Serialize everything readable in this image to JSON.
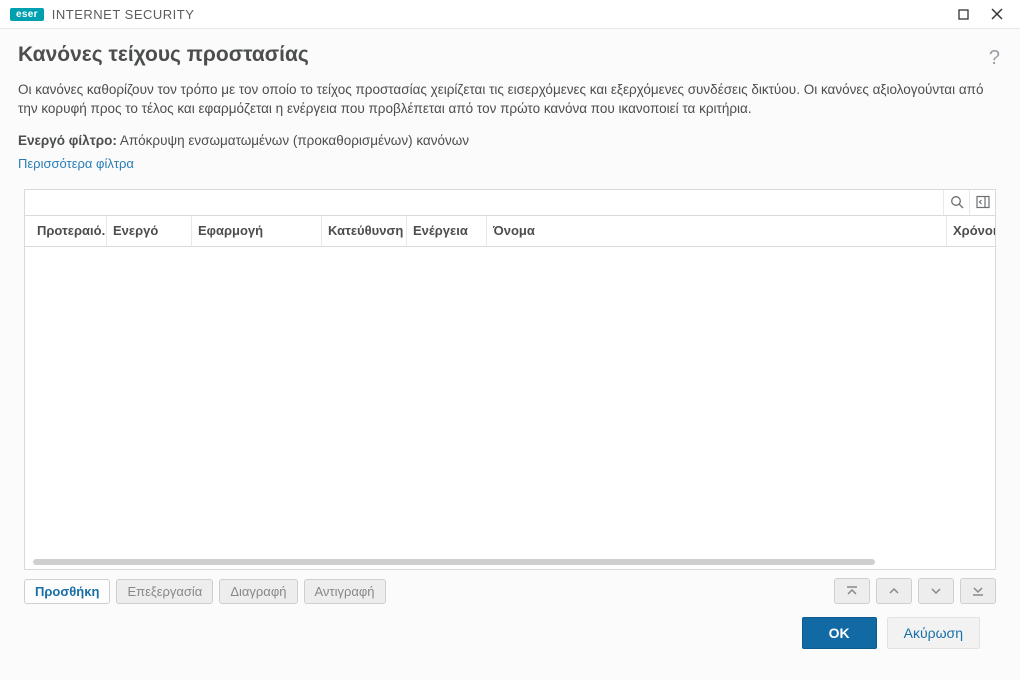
{
  "window": {
    "brand_badge": "eser",
    "brand_text": "INTERNET SECURITY"
  },
  "header": {
    "title": "Κανόνες τείχους προστασίας",
    "help_glyph": "?"
  },
  "description": "Οι κανόνες καθορίζουν τον τρόπο με τον οποίο το τείχος προστασίας χειρίζεται τις εισερχόμενες και εξερχόμενες συνδέσεις δικτύου. Οι κανόνες αξιολογούνται από την κορυφή προς το τέλος και εφαρμόζεται η ενέργεια που προβλέπεται από τον πρώτο κανόνα που ικανοποιεί τα κριτήρια.",
  "filter": {
    "label": "Ενεργό φίλτρο:",
    "value": "Απόκρυψη ενσωματωμένων (προκαθορισμένων) κανόνων",
    "more_link": "Περισσότερα φίλτρα"
  },
  "table": {
    "columns": {
      "priority": "Προτεραιό...",
      "active": "Ενεργό",
      "application": "Εφαρμογή",
      "direction": "Κατεύθυνση",
      "action": "Ενέργεια",
      "name": "Όνομα",
      "timeslots": "Χρόνοι"
    },
    "rows": []
  },
  "actions": {
    "add": "Προσθήκη",
    "edit": "Επεξεργασία",
    "delete": "Διαγραφή",
    "copy": "Αντιγραφή"
  },
  "footer": {
    "ok": "OK",
    "cancel": "Ακύρωση"
  }
}
